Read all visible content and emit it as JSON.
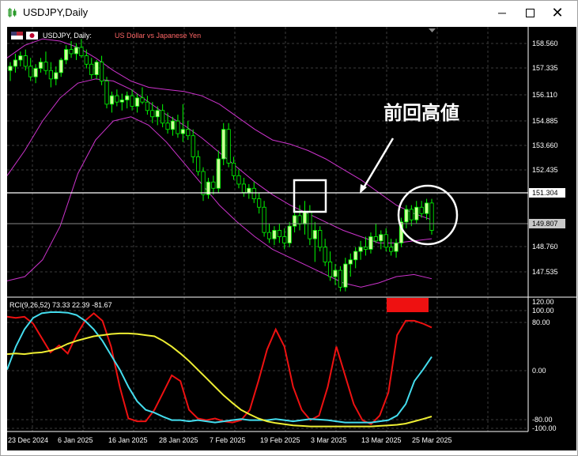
{
  "window": {
    "title": "USDJPY,Daily",
    "min_icon": "minimize-icon",
    "max_icon": "maximize-icon",
    "close_icon": "close-icon"
  },
  "colors": {
    "background": "#000000",
    "grid": "#3c3c3c",
    "axis_text": "#ffffff",
    "bull_candle": "#ccff99",
    "bear_candle": "#000000",
    "candle_outline": "#00ff00",
    "band": "#cc33cc",
    "rci_short": "#ee1111",
    "rci_mid": "#44ddee",
    "rci_long": "#eeee33",
    "annotation": "#ffffff",
    "marker_red": "#ee1111",
    "price_line_bg": "#ffffff"
  },
  "header": {
    "symbol": "USDJPY, Daily:",
    "description": "US Dollar vs Japanese Yen"
  },
  "annotation": {
    "label": "前回高値"
  },
  "price_axis": {
    "ticks": [
      "158.560",
      "157.335",
      "156.110",
      "154.885",
      "153.660",
      "152.435",
      "148.760",
      "147.535"
    ],
    "hline_label": "151.304",
    "current_label": "149.807"
  },
  "rci_panel": {
    "label": "RCI(9,26,52) 73.33 22.39 -81.67",
    "ticks": [
      "120.00",
      "100.00",
      "80.00",
      "0.00",
      "-80.00",
      "-100.00"
    ]
  },
  "time_axis": {
    "ticks": [
      "23 Dec 2024",
      "6 Jan 2025",
      "16 Jan 2025",
      "28 Jan 2025",
      "7 Feb 2025",
      "19 Feb 2025",
      "3 Mar 2025",
      "13 Mar 2025",
      "25 Mar 2025"
    ]
  },
  "chart_data": {
    "type": "candlestick",
    "price_range": [
      146.7,
      159.4
    ],
    "candles": [
      {
        "o": 157.4,
        "h": 157.8,
        "l": 156.9,
        "c": 157.6
      },
      {
        "o": 157.6,
        "h": 158.2,
        "l": 157.3,
        "c": 157.9
      },
      {
        "o": 157.9,
        "h": 158.3,
        "l": 157.6,
        "c": 158.1
      },
      {
        "o": 158.1,
        "h": 158.4,
        "l": 157.4,
        "c": 157.6
      },
      {
        "o": 157.6,
        "h": 158.0,
        "l": 156.9,
        "c": 157.1
      },
      {
        "o": 157.1,
        "h": 157.7,
        "l": 156.8,
        "c": 157.5
      },
      {
        "o": 157.5,
        "h": 158.0,
        "l": 157.3,
        "c": 157.8
      },
      {
        "o": 157.8,
        "h": 158.3,
        "l": 157.2,
        "c": 157.4
      },
      {
        "o": 157.4,
        "h": 157.8,
        "l": 156.6,
        "c": 157.0
      },
      {
        "o": 157.0,
        "h": 157.6,
        "l": 156.7,
        "c": 157.3
      },
      {
        "o": 157.3,
        "h": 158.0,
        "l": 157.1,
        "c": 157.9
      },
      {
        "o": 157.9,
        "h": 158.6,
        "l": 157.7,
        "c": 158.4
      },
      {
        "o": 158.4,
        "h": 158.8,
        "l": 158.0,
        "c": 158.2
      },
      {
        "o": 158.2,
        "h": 158.7,
        "l": 157.9,
        "c": 158.5
      },
      {
        "o": 158.5,
        "h": 158.9,
        "l": 158.0,
        "c": 158.1
      },
      {
        "o": 158.1,
        "h": 158.4,
        "l": 157.5,
        "c": 157.7
      },
      {
        "o": 157.7,
        "h": 158.0,
        "l": 157.0,
        "c": 157.2
      },
      {
        "o": 157.2,
        "h": 157.9,
        "l": 157.0,
        "c": 157.8
      },
      {
        "o": 157.8,
        "h": 158.1,
        "l": 156.7,
        "c": 156.9
      },
      {
        "o": 156.9,
        "h": 157.1,
        "l": 155.6,
        "c": 155.8
      },
      {
        "o": 155.8,
        "h": 156.4,
        "l": 155.4,
        "c": 156.2
      },
      {
        "o": 156.2,
        "h": 156.5,
        "l": 155.7,
        "c": 155.9
      },
      {
        "o": 155.9,
        "h": 156.3,
        "l": 155.5,
        "c": 156.0
      },
      {
        "o": 156.0,
        "h": 156.4,
        "l": 155.6,
        "c": 156.2
      },
      {
        "o": 156.2,
        "h": 156.5,
        "l": 155.5,
        "c": 155.7
      },
      {
        "o": 155.7,
        "h": 156.3,
        "l": 155.4,
        "c": 156.1
      },
      {
        "o": 156.1,
        "h": 156.6,
        "l": 155.8,
        "c": 155.9
      },
      {
        "o": 155.9,
        "h": 156.2,
        "l": 155.3,
        "c": 155.5
      },
      {
        "o": 155.5,
        "h": 155.9,
        "l": 154.9,
        "c": 155.2
      },
      {
        "o": 155.2,
        "h": 155.7,
        "l": 154.8,
        "c": 155.5
      },
      {
        "o": 155.5,
        "h": 155.8,
        "l": 154.7,
        "c": 154.9
      },
      {
        "o": 154.9,
        "h": 155.4,
        "l": 154.4,
        "c": 154.6
      },
      {
        "o": 154.6,
        "h": 155.2,
        "l": 154.3,
        "c": 155.0
      },
      {
        "o": 155.0,
        "h": 155.3,
        "l": 154.2,
        "c": 154.4
      },
      {
        "o": 154.4,
        "h": 155.8,
        "l": 154.0,
        "c": 154.6
      },
      {
        "o": 154.6,
        "h": 155.0,
        "l": 154.1,
        "c": 154.3
      },
      {
        "o": 154.3,
        "h": 154.6,
        "l": 153.0,
        "c": 153.3
      },
      {
        "o": 153.3,
        "h": 153.6,
        "l": 152.4,
        "c": 152.6
      },
      {
        "o": 152.6,
        "h": 152.8,
        "l": 151.2,
        "c": 151.5
      },
      {
        "o": 151.5,
        "h": 152.3,
        "l": 151.3,
        "c": 152.1
      },
      {
        "o": 152.1,
        "h": 152.4,
        "l": 151.5,
        "c": 151.8
      },
      {
        "o": 151.8,
        "h": 153.6,
        "l": 151.6,
        "c": 153.2
      },
      {
        "o": 153.2,
        "h": 154.9,
        "l": 152.9,
        "c": 154.6
      },
      {
        "o": 154.6,
        "h": 154.9,
        "l": 152.8,
        "c": 153.0
      },
      {
        "o": 153.0,
        "h": 153.3,
        "l": 152.2,
        "c": 152.4
      },
      {
        "o": 152.4,
        "h": 152.7,
        "l": 151.8,
        "c": 152.0
      },
      {
        "o": 152.0,
        "h": 152.3,
        "l": 151.4,
        "c": 151.6
      },
      {
        "o": 151.6,
        "h": 152.0,
        "l": 151.3,
        "c": 151.8
      },
      {
        "o": 151.8,
        "h": 152.1,
        "l": 151.1,
        "c": 151.3
      },
      {
        "o": 151.3,
        "h": 151.6,
        "l": 150.6,
        "c": 150.9
      },
      {
        "o": 150.9,
        "h": 151.2,
        "l": 149.5,
        "c": 149.7
      },
      {
        "o": 149.7,
        "h": 150.1,
        "l": 149.2,
        "c": 149.4
      },
      {
        "o": 149.4,
        "h": 150.0,
        "l": 149.1,
        "c": 149.8
      },
      {
        "o": 149.8,
        "h": 150.1,
        "l": 149.2,
        "c": 149.5
      },
      {
        "o": 149.5,
        "h": 149.9,
        "l": 148.9,
        "c": 149.2
      },
      {
        "o": 149.2,
        "h": 150.2,
        "l": 149.0,
        "c": 150.0
      },
      {
        "o": 150.0,
        "h": 150.8,
        "l": 149.7,
        "c": 150.5
      },
      {
        "o": 150.5,
        "h": 151.0,
        "l": 149.8,
        "c": 150.1
      },
      {
        "o": 150.1,
        "h": 151.2,
        "l": 149.6,
        "c": 150.7
      },
      {
        "o": 150.7,
        "h": 151.0,
        "l": 149.1,
        "c": 149.4
      },
      {
        "o": 149.4,
        "h": 150.2,
        "l": 148.3,
        "c": 149.8
      },
      {
        "o": 149.8,
        "h": 150.0,
        "l": 148.8,
        "c": 149.0
      },
      {
        "o": 149.0,
        "h": 149.4,
        "l": 148.1,
        "c": 148.3
      },
      {
        "o": 148.3,
        "h": 148.8,
        "l": 147.4,
        "c": 147.6
      },
      {
        "o": 147.6,
        "h": 148.2,
        "l": 147.2,
        "c": 147.9
      },
      {
        "o": 147.9,
        "h": 148.1,
        "l": 146.9,
        "c": 147.1
      },
      {
        "o": 147.1,
        "h": 148.5,
        "l": 146.9,
        "c": 148.2
      },
      {
        "o": 148.2,
        "h": 148.7,
        "l": 147.6,
        "c": 148.4
      },
      {
        "o": 148.4,
        "h": 149.0,
        "l": 148.0,
        "c": 148.8
      },
      {
        "o": 148.8,
        "h": 149.3,
        "l": 148.4,
        "c": 149.0
      },
      {
        "o": 149.0,
        "h": 149.5,
        "l": 148.6,
        "c": 148.9
      },
      {
        "o": 148.9,
        "h": 149.7,
        "l": 148.7,
        "c": 149.5
      },
      {
        "o": 149.5,
        "h": 150.1,
        "l": 149.2,
        "c": 149.3
      },
      {
        "o": 149.3,
        "h": 149.8,
        "l": 148.9,
        "c": 149.6
      },
      {
        "o": 149.6,
        "h": 149.9,
        "l": 148.8,
        "c": 149.0
      },
      {
        "o": 149.0,
        "h": 149.4,
        "l": 148.6,
        "c": 148.8
      },
      {
        "o": 148.8,
        "h": 149.4,
        "l": 148.5,
        "c": 149.2
      },
      {
        "o": 149.2,
        "h": 150.4,
        "l": 149.0,
        "c": 150.2
      },
      {
        "o": 150.2,
        "h": 151.0,
        "l": 149.9,
        "c": 150.8
      },
      {
        "o": 150.8,
        "h": 151.0,
        "l": 150.0,
        "c": 150.3
      },
      {
        "o": 150.3,
        "h": 151.2,
        "l": 150.1,
        "c": 150.9
      },
      {
        "o": 150.9,
        "h": 151.2,
        "l": 150.4,
        "c": 150.6
      },
      {
        "o": 150.6,
        "h": 151.3,
        "l": 150.3,
        "c": 151.1
      },
      {
        "o": 151.1,
        "h": 151.3,
        "l": 149.6,
        "c": 149.8
      }
    ],
    "band_upper": [
      158.0,
      158.6,
      158.9,
      158.8,
      158.5,
      158.0,
      157.4,
      156.9,
      156.6,
      156.5,
      156.4,
      156.2,
      155.8,
      155.2,
      154.6,
      154.1,
      153.9,
      153.6,
      153.2,
      152.7,
      152.2,
      151.6,
      151.0,
      150.6,
      150.3
    ],
    "band_mid": [
      152.4,
      153.6,
      155.0,
      156.1,
      156.8,
      157.0,
      156.9,
      156.5,
      155.9,
      155.3,
      154.8,
      154.2,
      153.5,
      152.8,
      152.1,
      151.5,
      151.0,
      150.6,
      150.2,
      149.8,
      149.5,
      149.2,
      149.2,
      149.3,
      149.4
    ],
    "band_lower": [
      147.4,
      147.6,
      148.4,
      150.0,
      152.5,
      154.1,
      155.0,
      155.2,
      154.8,
      154.0,
      153.0,
      152.0,
      151.0,
      150.2,
      149.5,
      148.9,
      148.5,
      148.1,
      147.7,
      147.3,
      147.1,
      147.3,
      147.6,
      147.7,
      147.5
    ],
    "rci": {
      "range": [
        -105,
        122
      ],
      "series": [
        {
          "values": [
            92,
            90,
            92,
            80,
            55,
            30,
            42,
            28,
            60,
            85,
            98,
            85,
            40,
            -30,
            -85,
            -90,
            -90,
            -70,
            -40,
            -10,
            -20,
            -70,
            -85,
            -88,
            -85,
            -90,
            -92,
            -88,
            -70,
            -20,
            35,
            70,
            40,
            -30,
            -70,
            -88,
            -80,
            -30,
            40,
            -10,
            -60,
            -88,
            -95,
            -80,
            -40,
            60,
            85,
            85,
            80,
            73.33
          ]
        },
        {
          "values": [
            0,
            40,
            70,
            90,
            98,
            100,
            100,
            99,
            95,
            85,
            70,
            50,
            25,
            0,
            -30,
            -55,
            -70,
            -75,
            -82,
            -88,
            -88,
            -90,
            -88,
            -90,
            -92,
            -90,
            -88,
            -86,
            -88,
            -88,
            -88,
            -86,
            -88,
            -90,
            -88,
            -86,
            -87,
            -88,
            -90,
            -92,
            -92,
            -92,
            -92,
            -90,
            -88,
            -80,
            -60,
            -20,
            0,
            22.39
          ]
        },
        {
          "values": [
            27,
            28,
            27,
            29,
            30,
            33,
            38,
            45,
            50,
            54,
            58,
            60,
            62,
            63,
            63,
            62,
            60,
            58,
            50,
            40,
            28,
            15,
            0,
            -15,
            -30,
            -45,
            -58,
            -70,
            -78,
            -85,
            -90,
            -93,
            -95,
            -97,
            -98,
            -99,
            -99,
            -99,
            -99,
            -99,
            -99,
            -99,
            -99,
            -98,
            -97,
            -96,
            -94,
            -90,
            -86,
            -81.67
          ]
        }
      ]
    }
  }
}
